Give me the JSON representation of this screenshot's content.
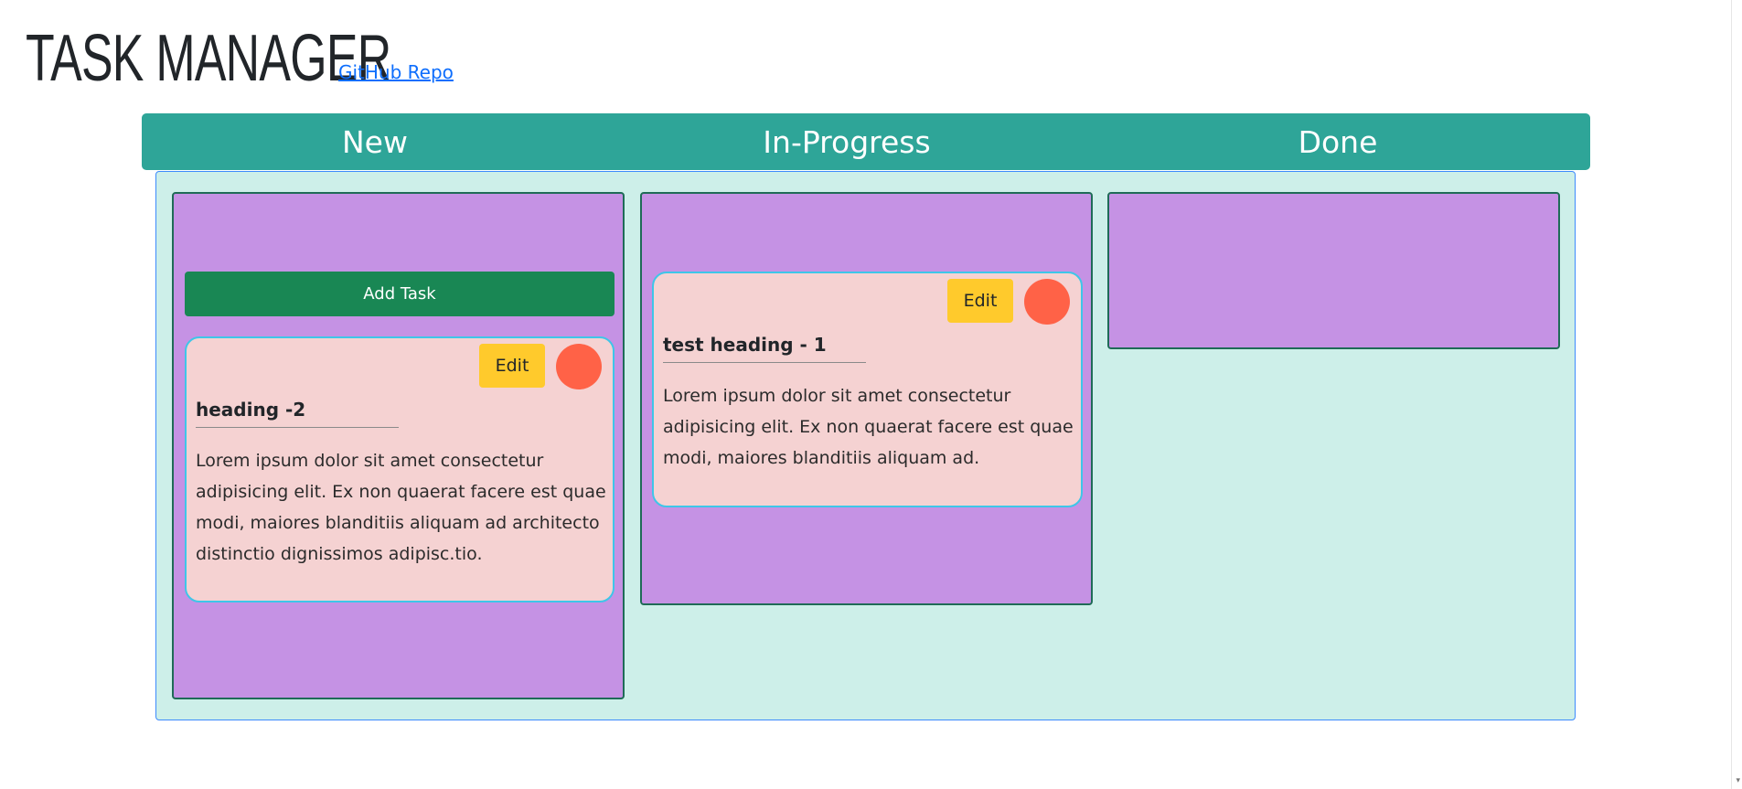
{
  "header": {
    "title": "TASK MANAGER",
    "repo_link": "GitHub Repo"
  },
  "columns": [
    {
      "title": "New"
    },
    {
      "title": "In-Progress"
    },
    {
      "title": "Done"
    }
  ],
  "new_column": {
    "add_task_label": "Add Task",
    "tasks": [
      {
        "edit_label": "Edit",
        "heading": "heading -2",
        "body": "Lorem ipsum dolor sit amet consectetur adipisicing elit. Ex non quaerat facere est quae modi, maiores blanditiis aliquam ad architecto distinctio dignissimos adipisc.tio."
      }
    ]
  },
  "in_progress_column": {
    "tasks": [
      {
        "edit_label": "Edit",
        "heading": "test heading - 1",
        "body": "Lorem ipsum dolor sit amet consectetur adipisicing elit. Ex non quaerat facere est quae modi, maiores blanditiis aliquam ad."
      }
    ]
  },
  "done_column": {
    "tasks": []
  },
  "colors": {
    "header_bar": "#2ea598",
    "board_bg": "#cdefe9",
    "column_bg": "#c592e4",
    "card_bg": "#f5d2d2",
    "add_button": "#198754",
    "edit_button": "#ffca2c",
    "delete_button": "#ff6247",
    "link": "#0d6efd"
  },
  "icons": {
    "delete": "delete-circle-icon"
  }
}
